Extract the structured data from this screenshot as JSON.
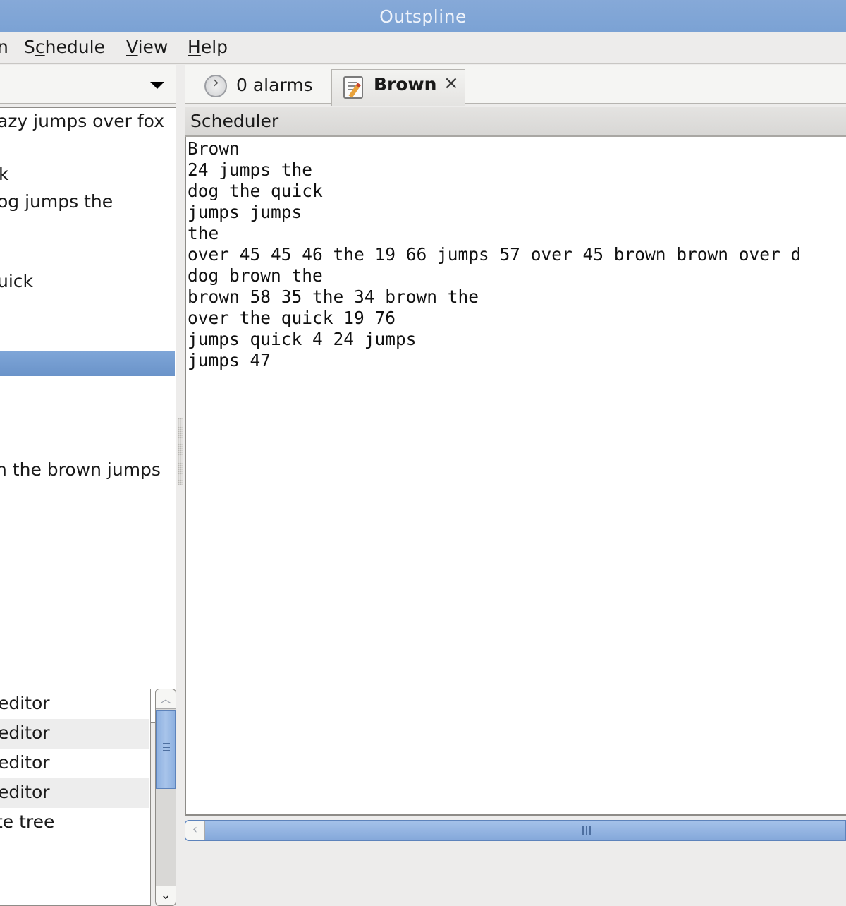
{
  "window": {
    "title": "Outspline"
  },
  "menubar": {
    "items": [
      {
        "label": "n",
        "mnemonic_index": -1
      },
      {
        "label_pre": "S",
        "label_mn": "c",
        "label_post": "hedule"
      },
      {
        "label_pre": "",
        "label_mn": "V",
        "label_post": "iew"
      },
      {
        "label_pre": "",
        "label_mn": "H",
        "label_post": "elp"
      }
    ]
  },
  "left_pane": {
    "database_selector": {
      "value": ""
    },
    "tree": {
      "items": [
        {
          "label": "azy jumps over fox",
          "selected": false
        },
        {
          "label": "k",
          "selected": false
        },
        {
          "label": "og jumps the",
          "selected": false
        },
        {
          "label": "uick",
          "selected": false
        },
        {
          "label": "",
          "selected": true
        },
        {
          "label": "n the brown jumps",
          "selected": false
        }
      ]
    },
    "history": {
      "items": [
        {
          "label": "editor"
        },
        {
          "label": "editor"
        },
        {
          "label": "editor"
        },
        {
          "label": "editor"
        },
        {
          "label": "te tree"
        }
      ]
    }
  },
  "right_pane": {
    "tabs": [
      {
        "label": "0 alarms",
        "icon": "clock-icon",
        "active": false
      },
      {
        "label": "Brown",
        "icon": "edit-note-icon",
        "active": true,
        "closable": true,
        "close_glyph": "×"
      }
    ],
    "panel_header": "Scheduler",
    "editor_text": "Brown\n24 jumps the\ndog the quick\njumps jumps\nthe\nover 45 45 46 the 19 66 jumps 57 over 45 brown brown over d\ndog brown the\nbrown 58 35 the 34 brown the\nover the quick 19 76\njumps quick 4 24 jumps\njumps 47"
  },
  "scrollbars": {
    "up_glyph": "︿",
    "down_glyph": "⌄",
    "left_glyph": "‹"
  }
}
